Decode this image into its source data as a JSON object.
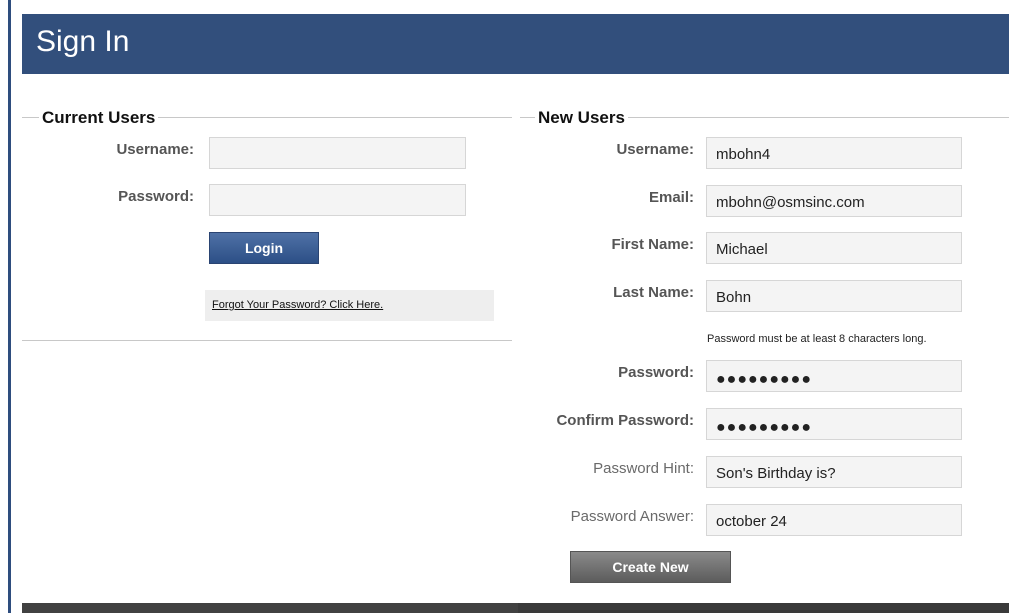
{
  "header": {
    "title": "Sign In"
  },
  "current_users": {
    "title": "Current Users",
    "username_label": "Username:",
    "username_value": "",
    "password_label": "Password:",
    "password_value": "",
    "login_label": "Login",
    "forgot_link": "Forgot Your Password? Click Here."
  },
  "new_users": {
    "title": "New Users",
    "username_label": "Username:",
    "username_value": "mbohn4",
    "email_label": "Email:",
    "email_value": "mbohn@osmsinc.com",
    "first_name_label": "First Name:",
    "first_name_value": "Michael",
    "last_name_label": "Last Name:",
    "last_name_value": "Bohn",
    "password_requirement": "Password must be at least 8 characters long.",
    "password_label": "Password:",
    "password_value": "●●●●●●●●●",
    "confirm_password_label": "Confirm Password:",
    "confirm_password_value": "●●●●●●●●●",
    "hint_label": "Password Hint:",
    "hint_value": "Son's Birthday is?",
    "answer_label": "Password Answer:",
    "answer_value": "october 24",
    "create_label": "Create New"
  },
  "colors": {
    "header_bg": "#324f7c",
    "login_button": "#3d5f96",
    "create_button": "#707070"
  }
}
